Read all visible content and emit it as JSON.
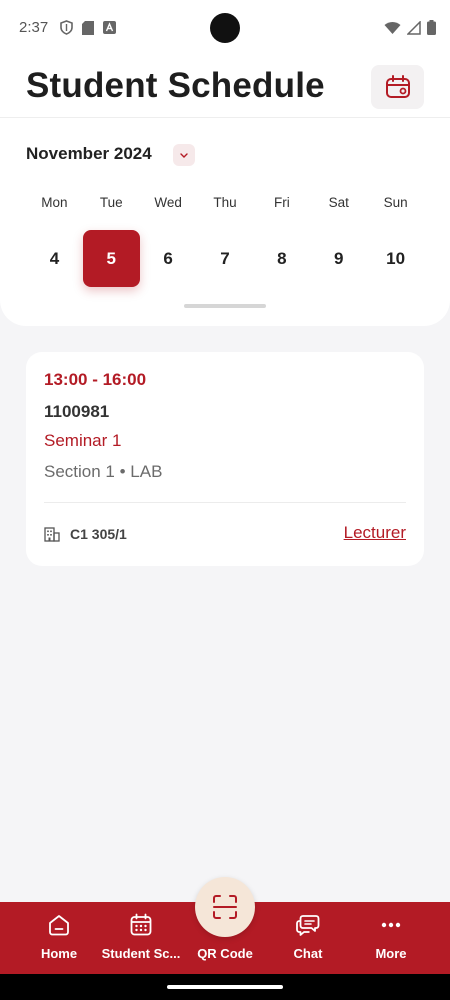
{
  "status_bar": {
    "time": "2:37",
    "left_icons": [
      "shield-icon",
      "sd-card-icon",
      "a-box-icon"
    ],
    "right_icons": [
      "wifi-icon",
      "signal-icon",
      "battery-icon"
    ]
  },
  "header": {
    "title": "Student Schedule",
    "calendar_button_icon": "calendar-icon"
  },
  "calendar": {
    "month": "November 2024",
    "weekdays": [
      "Mon",
      "Tue",
      "Wed",
      "Thu",
      "Fri",
      "Sat",
      "Sun"
    ],
    "dates": [
      "4",
      "5",
      "6",
      "7",
      "8",
      "9",
      "10"
    ],
    "selected_date": "5"
  },
  "class_card": {
    "time": "13:00 - 16:00",
    "code": "1100981",
    "name": "Seminar 1",
    "section": "Section 1 • LAB",
    "room": "C1 305/1",
    "lecturer_link": "Lecturer"
  },
  "bottom_nav": {
    "items": [
      {
        "label": "Home",
        "icon": "home-icon"
      },
      {
        "label": "Student Sc...",
        "icon": "calendar-grid-icon"
      },
      {
        "label": "QR Code",
        "icon": "qr-scan-icon"
      },
      {
        "label": "Chat",
        "icon": "chat-icon"
      },
      {
        "label": "More",
        "icon": "more-dots-icon"
      }
    ]
  },
  "colors": {
    "accent": "#b31b25",
    "background": "#f5f5f7",
    "qr_bubble": "#f5e6d8"
  }
}
